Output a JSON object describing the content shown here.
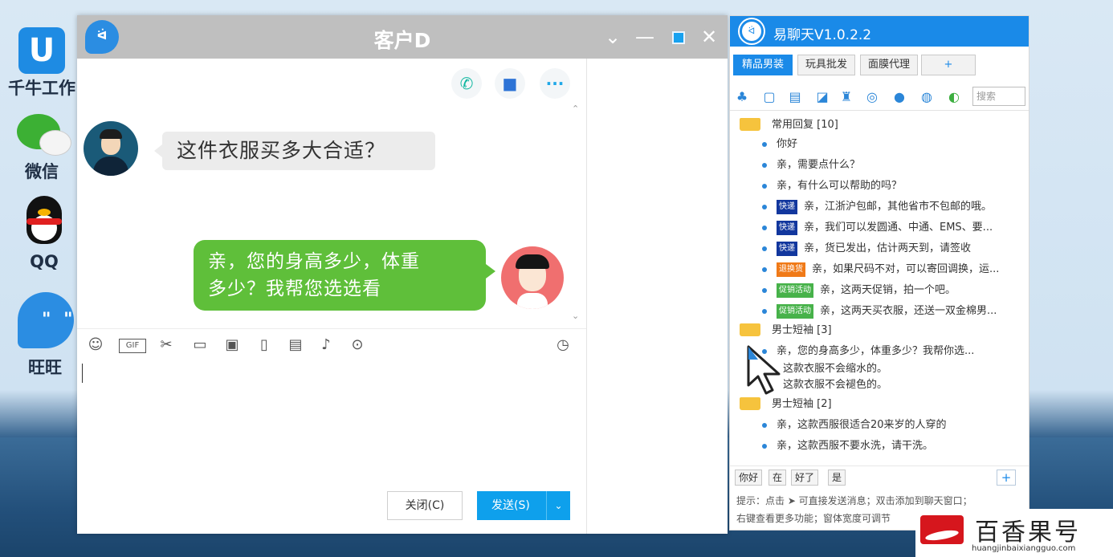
{
  "desktop": {
    "icons": [
      {
        "label": "千牛工作",
        "glyph": "U"
      },
      {
        "label": "微信"
      },
      {
        "label": "QQ"
      },
      {
        "label": "旺旺",
        "glyph": "\" \""
      }
    ]
  },
  "chat": {
    "title": "客户D",
    "window_controls": {
      "chevron": "⌄",
      "minimize": "—",
      "close": "✕"
    },
    "call_icons": {
      "phone": "✆",
      "video": "■",
      "more": "···"
    },
    "scroll_up": "⌃",
    "scroll_down": "⌄",
    "messages": [
      {
        "from": "customer",
        "text": "这件衣服买多大合适？"
      },
      {
        "from": "me",
        "line1": "亲，您的身高多少，体重",
        "line2": "多少？我帮您选选看"
      }
    ],
    "toolbar": {
      "emoji": "☺",
      "gif": "GIF",
      "scissors": "✂",
      "folder": "▭",
      "image": "▣",
      "shake": "▯",
      "calendar": "▤",
      "music": "♪",
      "more": "⊙",
      "history": "◷"
    },
    "close_label": "关闭(C)",
    "send_label": "发送(S)",
    "send_arrow": "⌄"
  },
  "quick_reply": {
    "logo_text": "ᐛ",
    "title": "易聊天V1.0.2.2",
    "tabs": [
      "精品男装",
      "玩具批发",
      "面膜代理",
      "+"
    ],
    "tool_glyphs": [
      "♣",
      "▢",
      "▤",
      "◪",
      "♜",
      "◎",
      "●",
      "◍",
      "◐"
    ],
    "search_placeholder": "搜索",
    "groups": [
      {
        "name": "常用回复 [10]",
        "items": [
          {
            "tag": "",
            "text": "你好"
          },
          {
            "tag": "",
            "text": "亲，需要点什么？"
          },
          {
            "tag": "",
            "text": "亲，有什么可以帮助的吗？"
          },
          {
            "tag": "快递",
            "tag_color": "blue",
            "text": "亲，江浙沪包邮，其他省市不包邮的哦。"
          },
          {
            "tag": "快递",
            "tag_color": "blue",
            "text": "亲，我们可以发圆通、中通、EMS、要..."
          },
          {
            "tag": "快递",
            "tag_color": "blue",
            "text": "亲，货已发出，估计两天到，请签收"
          },
          {
            "tag": "退换货",
            "tag_color": "orange",
            "text": "亲，如果尺码不对，可以寄回调换，运..."
          },
          {
            "tag": "促销活动",
            "tag_color": "green",
            "text": "亲，这两天促销，拍一个吧。"
          },
          {
            "tag": "促销活动",
            "tag_color": "green",
            "text": "亲，这两天买衣服，还送一双金棉男..."
          }
        ]
      },
      {
        "name": "男士短袖 [3]",
        "items": [
          {
            "tag": "",
            "text": "亲，您的身高多少，体重多少？我帮你选..."
          },
          {
            "tag": "",
            "text": "这款衣服不会缩水的。"
          },
          {
            "tag": "",
            "text": "这款衣服不会褪色的。"
          }
        ]
      },
      {
        "name": "男士短袖 [2]",
        "items": [
          {
            "tag": "",
            "text": "亲，这款西服很适合20来岁的人穿的"
          },
          {
            "tag": "",
            "text": "亲，这款西服不要水洗，请干洗。"
          }
        ]
      }
    ],
    "quick_chips": [
      "你好",
      "在",
      "好了",
      "是"
    ],
    "add_chip": "+",
    "tip_line1": "提示：点击 ➤ 可直接发送消息；双击添加到聊天窗口；",
    "tip_line2": "右键查看更多功能；窗体宽度可调节"
  },
  "watermark": {
    "title": "百香果号",
    "url": "huangjinbaixiangguo.com"
  }
}
